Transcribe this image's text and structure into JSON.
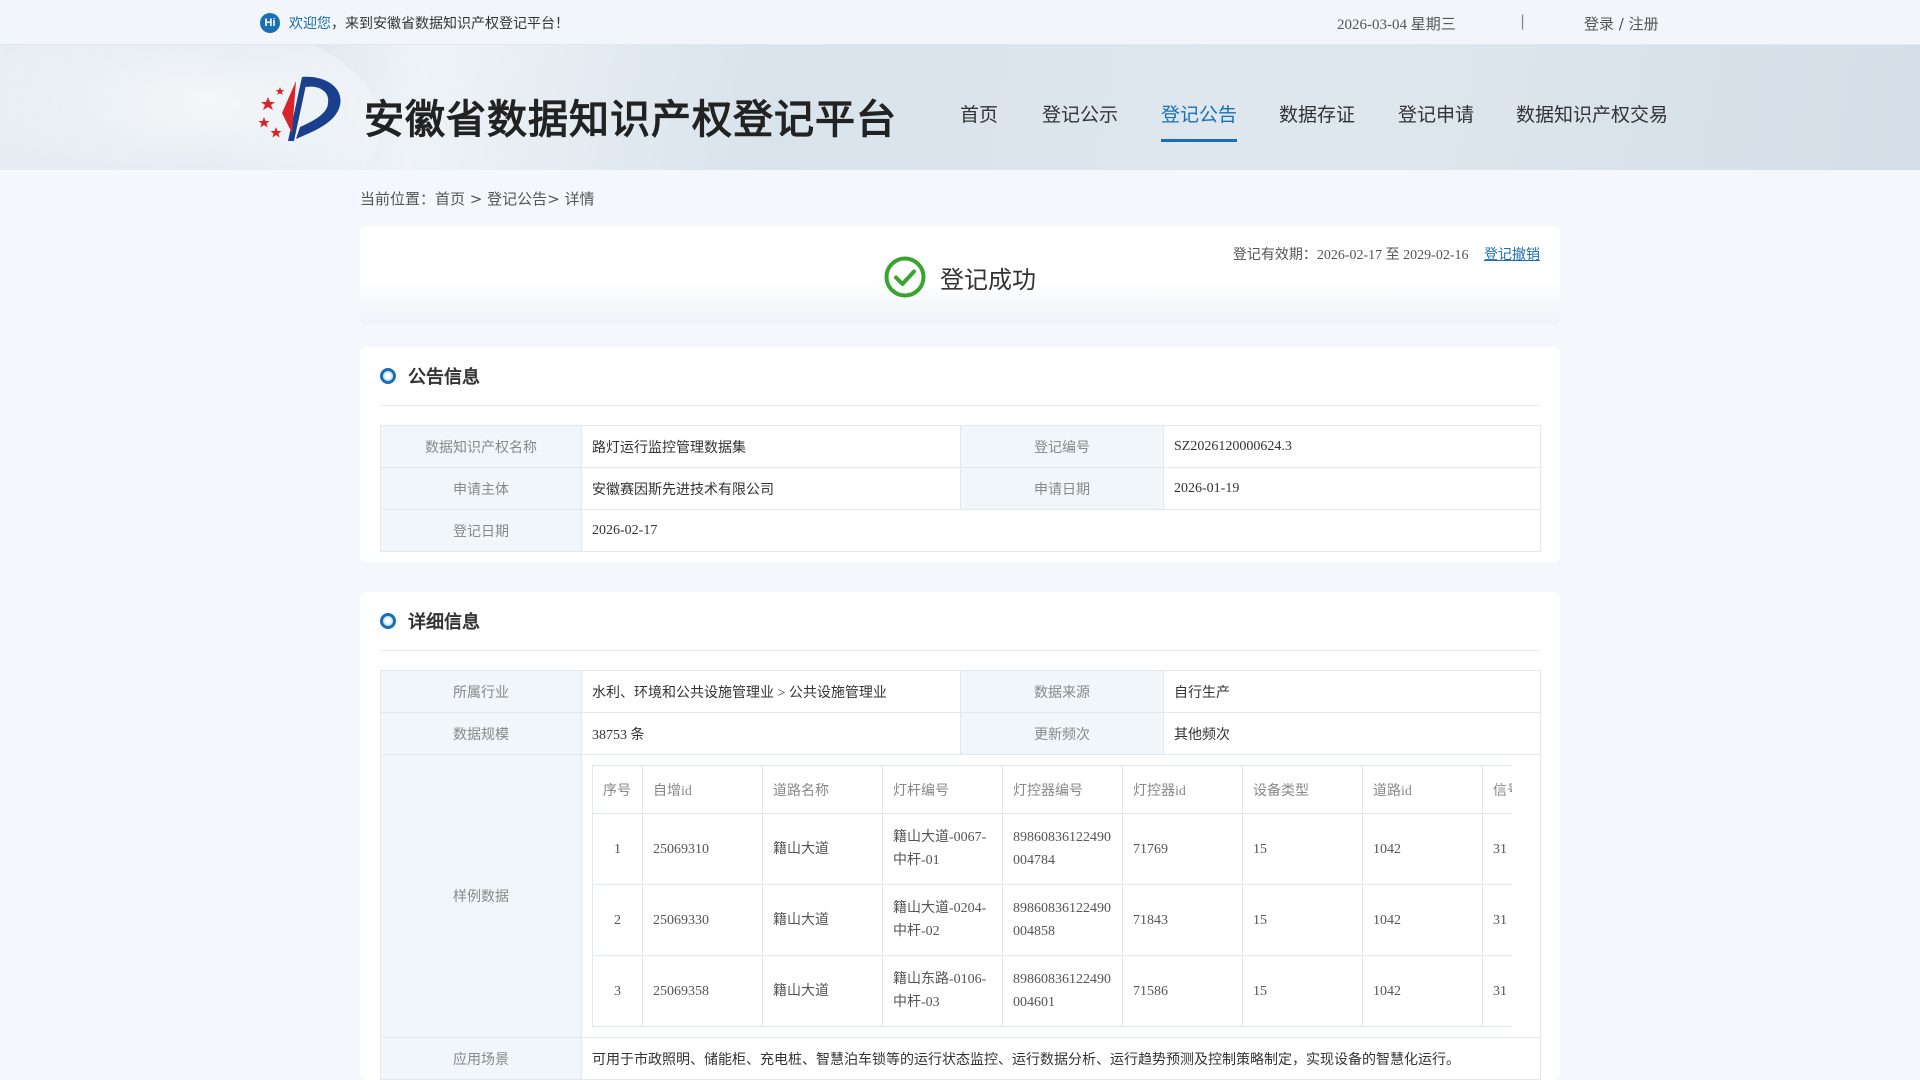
{
  "topbar": {
    "hi": "Hi",
    "welcome_highlight": "欢迎您",
    "welcome_text": "，来到安徽省数据知识产权登记平台！",
    "date": "2026-03-04 星期三",
    "separator": "|",
    "login": "登录 / 注册"
  },
  "header": {
    "site_title": "安徽省数据知识产权登记平台",
    "nav": [
      "首页",
      "登记公示",
      "登记公告",
      "数据存证",
      "登记申请",
      "数据知识产权交易"
    ],
    "active_nav": "登记公告"
  },
  "breadcrumb": "当前位置：首页 > 登记公告> 详情",
  "status": {
    "text": "登记成功",
    "validity": "登记有效期：2026-02-17 至 2029-02-16",
    "revoke": "登记撤销"
  },
  "notice": {
    "title": "公告信息",
    "name_label": "数据知识产权名称",
    "name_value": "路灯运行监控管理数据集",
    "reg_no_label": "登记编号",
    "reg_no_value": "SZ2026120000624.3",
    "applicant_label": "申请主体",
    "applicant_value": "安徽赛因斯先进技术有限公司",
    "apply_date_label": "申请日期",
    "apply_date_value": "2026-01-19",
    "reg_date_label": "登记日期",
    "reg_date_value": "2026-02-17"
  },
  "detail": {
    "title": "详细信息",
    "industry_label": "所属行业",
    "industry_value": "水利、环境和公共设施管理业 > 公共设施管理业",
    "source_label": "数据来源",
    "source_value": "自行生产",
    "scale_label": "数据规模",
    "scale_value": "38753 条",
    "freq_label": "更新频次",
    "freq_value": "其他频次",
    "sample_label": "样例数据",
    "scenario_label": "应用场景",
    "scenario_value": "可用于市政照明、储能柜、充电桩、智慧泊车锁等的运行状态监控、运行数据分析、运行趋势预测及控制策略制定，实现设备的智慧化运行。"
  },
  "sample": {
    "headers": [
      "序号",
      "自增id",
      "道路名称",
      "灯杆编号",
      "灯控器编号",
      "灯控器id",
      "设备类型",
      "道路id",
      "信号"
    ],
    "rows": [
      [
        "1",
        "25069310",
        "籍山大道",
        "籍山大道-0067-中杆-01",
        "89860836122490004784",
        "71769",
        "15",
        "1042",
        "31"
      ],
      [
        "2",
        "25069330",
        "籍山大道",
        "籍山大道-0204-中杆-02",
        "89860836122490004858",
        "71843",
        "15",
        "1042",
        "31"
      ],
      [
        "3",
        "25069358",
        "籍山大道",
        "籍山东路-0106-中杆-03",
        "89860836122490004601",
        "71586",
        "15",
        "1042",
        "31"
      ]
    ]
  },
  "colors": {
    "brand": "#1a6fb5",
    "success": "#3aa52e",
    "logo_red": "#d9232a",
    "logo_blue": "#1a3f8c"
  }
}
